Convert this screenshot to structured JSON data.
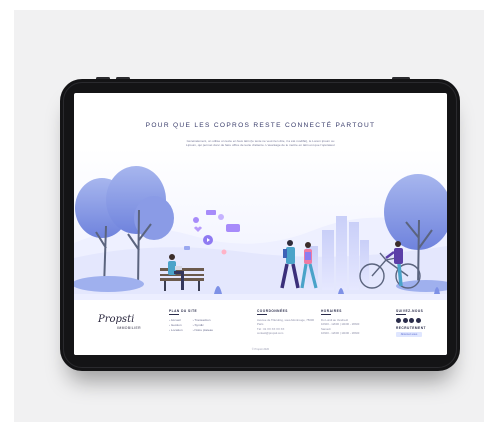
{
  "hero": {
    "title": "POUR QUE LES COPROS RESTE CONNECTÉ PARTOUT",
    "text": "Généralement, on utilise un texte en faux latin (le texte ne veut rien dire, il a été modifié), le Lorem ipsum ou Lipsum, qui permet donc de faire office de texte d'attente. L'avantage de le mettre en latin est que l'opérateur sait au premier coup d'oeil que la page contenant ces lignes"
  },
  "brand": {
    "logo": "Propsti",
    "sub": "IMMOBILIER"
  },
  "footer": {
    "plan": {
      "heading": "PLAN DU SITE",
      "col1": [
        "› Accueil",
        "› Gestion",
        "› Location"
      ],
      "col2": [
        "› Transaction",
        "› Syndic",
        "› Notre plateau"
      ]
    },
    "contact": {
      "heading": "COORDONNÉES",
      "lines": [
        "Avenue de Tilleruling, sous-Montrouge, 75000 Paris",
        "Tél : 01 XX XX XX XX",
        "contact@propsti.com"
      ]
    },
    "hours": {
      "heading": "HORAIRES",
      "lines": [
        "Du Lundi au Vendredi",
        "10h00 - 12h00 | 14h00 - 18h00",
        "Samedi",
        "10h00 - 12h00 | 14h00 - 18h00"
      ]
    },
    "follow": {
      "heading": "SUIVEZ-NOUS",
      "subscribe_heading": "RECRUTEMENT",
      "subscribe_label": "Abonnez-vous"
    },
    "copyright": "© Propsti 2020"
  },
  "colors": {
    "accent": "#5b6bcf",
    "purple": "#a78bfa",
    "title": "#3a3d6b",
    "tablet": "#141416"
  }
}
